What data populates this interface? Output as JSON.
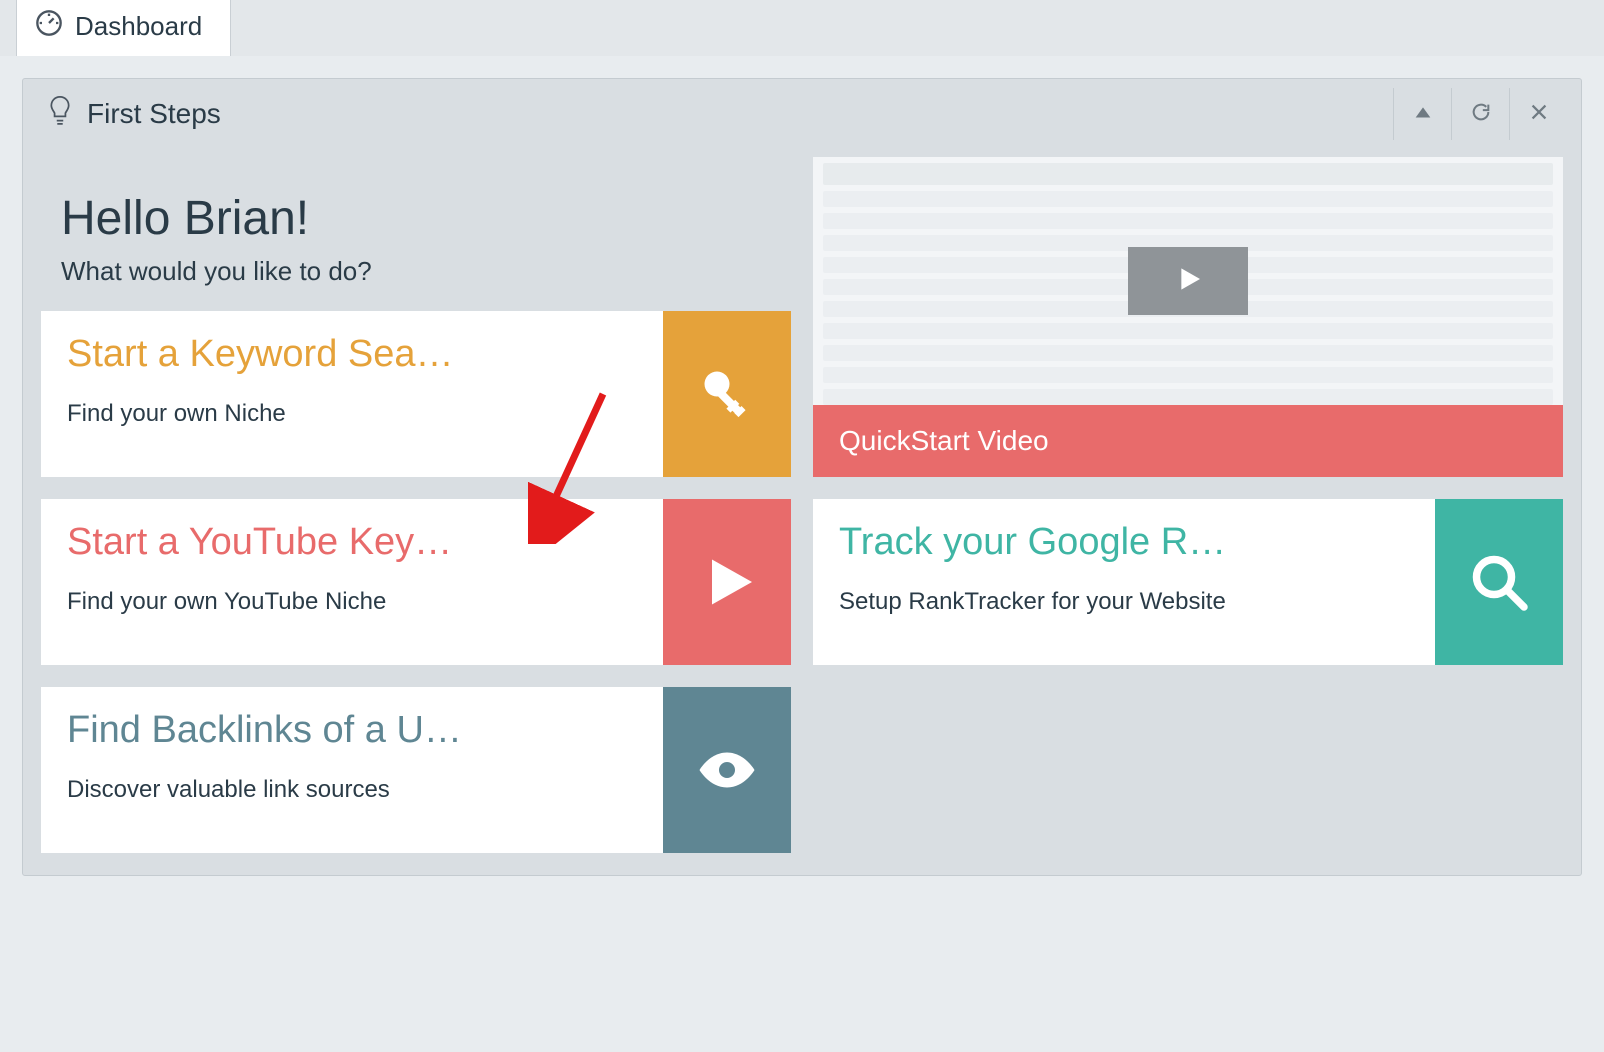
{
  "tab": {
    "label": "Dashboard"
  },
  "panel": {
    "title": "First Steps"
  },
  "greeting": {
    "heading": "Hello Brian!",
    "sub": "What would you like to do?"
  },
  "cards": {
    "keyword": {
      "title": "Start a Keyword Sea…",
      "sub": "Find your own Niche"
    },
    "youtube": {
      "title": "Start a YouTube Key…",
      "sub": "Find your own YouTube Niche"
    },
    "backlinks": {
      "title": "Find Backlinks of a U…",
      "sub": "Discover valuable link sources"
    },
    "track": {
      "title": "Track your Google R…",
      "sub": "Setup RankTracker for your Website"
    }
  },
  "video": {
    "label": "QuickStart Video"
  },
  "colors": {
    "orange": "#e5a23a",
    "red": "#e86b6b",
    "teal": "#3fb5a4",
    "slate": "#5f8693"
  }
}
